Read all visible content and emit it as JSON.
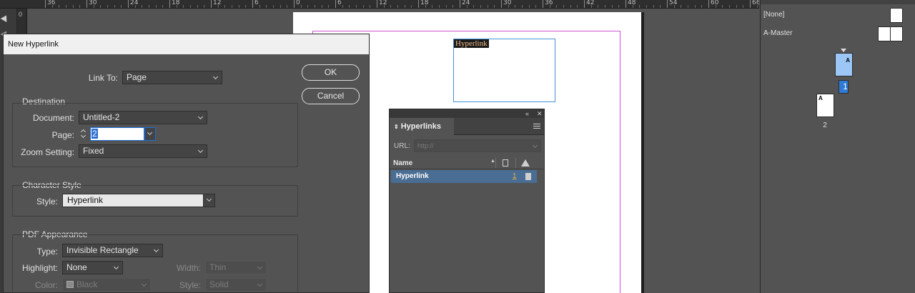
{
  "ruler": {
    "labels": [
      "36",
      "30",
      "24",
      "18",
      "12",
      "6",
      "0",
      "6",
      "12",
      "18",
      "24",
      "30",
      "36",
      "42",
      "48",
      "54",
      "60",
      "66"
    ],
    "vertical_label": "0"
  },
  "document": {
    "frame_text": "Hyperlink"
  },
  "pages_panel": {
    "masters": [
      {
        "label": "[None]"
      },
      {
        "label": "A-Master"
      }
    ],
    "pages": [
      {
        "number": "1",
        "master_prefix": "A",
        "selected": true
      },
      {
        "number": "2",
        "master_prefix": "A",
        "selected": false
      }
    ]
  },
  "hyperlinks_panel": {
    "tab_label": "Hyperlinks",
    "url_label": "URL:",
    "url_placeholder": "http://",
    "column_name": "Name",
    "rows": [
      {
        "name": "Hyperlink",
        "count": "1"
      }
    ]
  },
  "dialog": {
    "title": "New Hyperlink",
    "link_to_label": "Link To:",
    "link_to_value": "Page",
    "ok_label": "OK",
    "cancel_label": "Cancel",
    "destination": {
      "title": "Destination",
      "document_label": "Document:",
      "document_value": "Untitled-2",
      "page_label": "Page:",
      "page_value": "2",
      "zoom_label": "Zoom Setting:",
      "zoom_value": "Fixed"
    },
    "character_style": {
      "title": "Character Style",
      "style_label": "Style:",
      "style_value": "Hyperlink"
    },
    "pdf_appearance": {
      "title": "PDF Appearance",
      "type_label": "Type:",
      "type_value": "Invisible Rectangle",
      "highlight_label": "Highlight:",
      "highlight_value": "None",
      "width_label": "Width:",
      "width_value": "Thin",
      "color_label": "Color:",
      "color_value": "Black",
      "style_label": "Style:",
      "style_value": "Solid"
    }
  }
}
